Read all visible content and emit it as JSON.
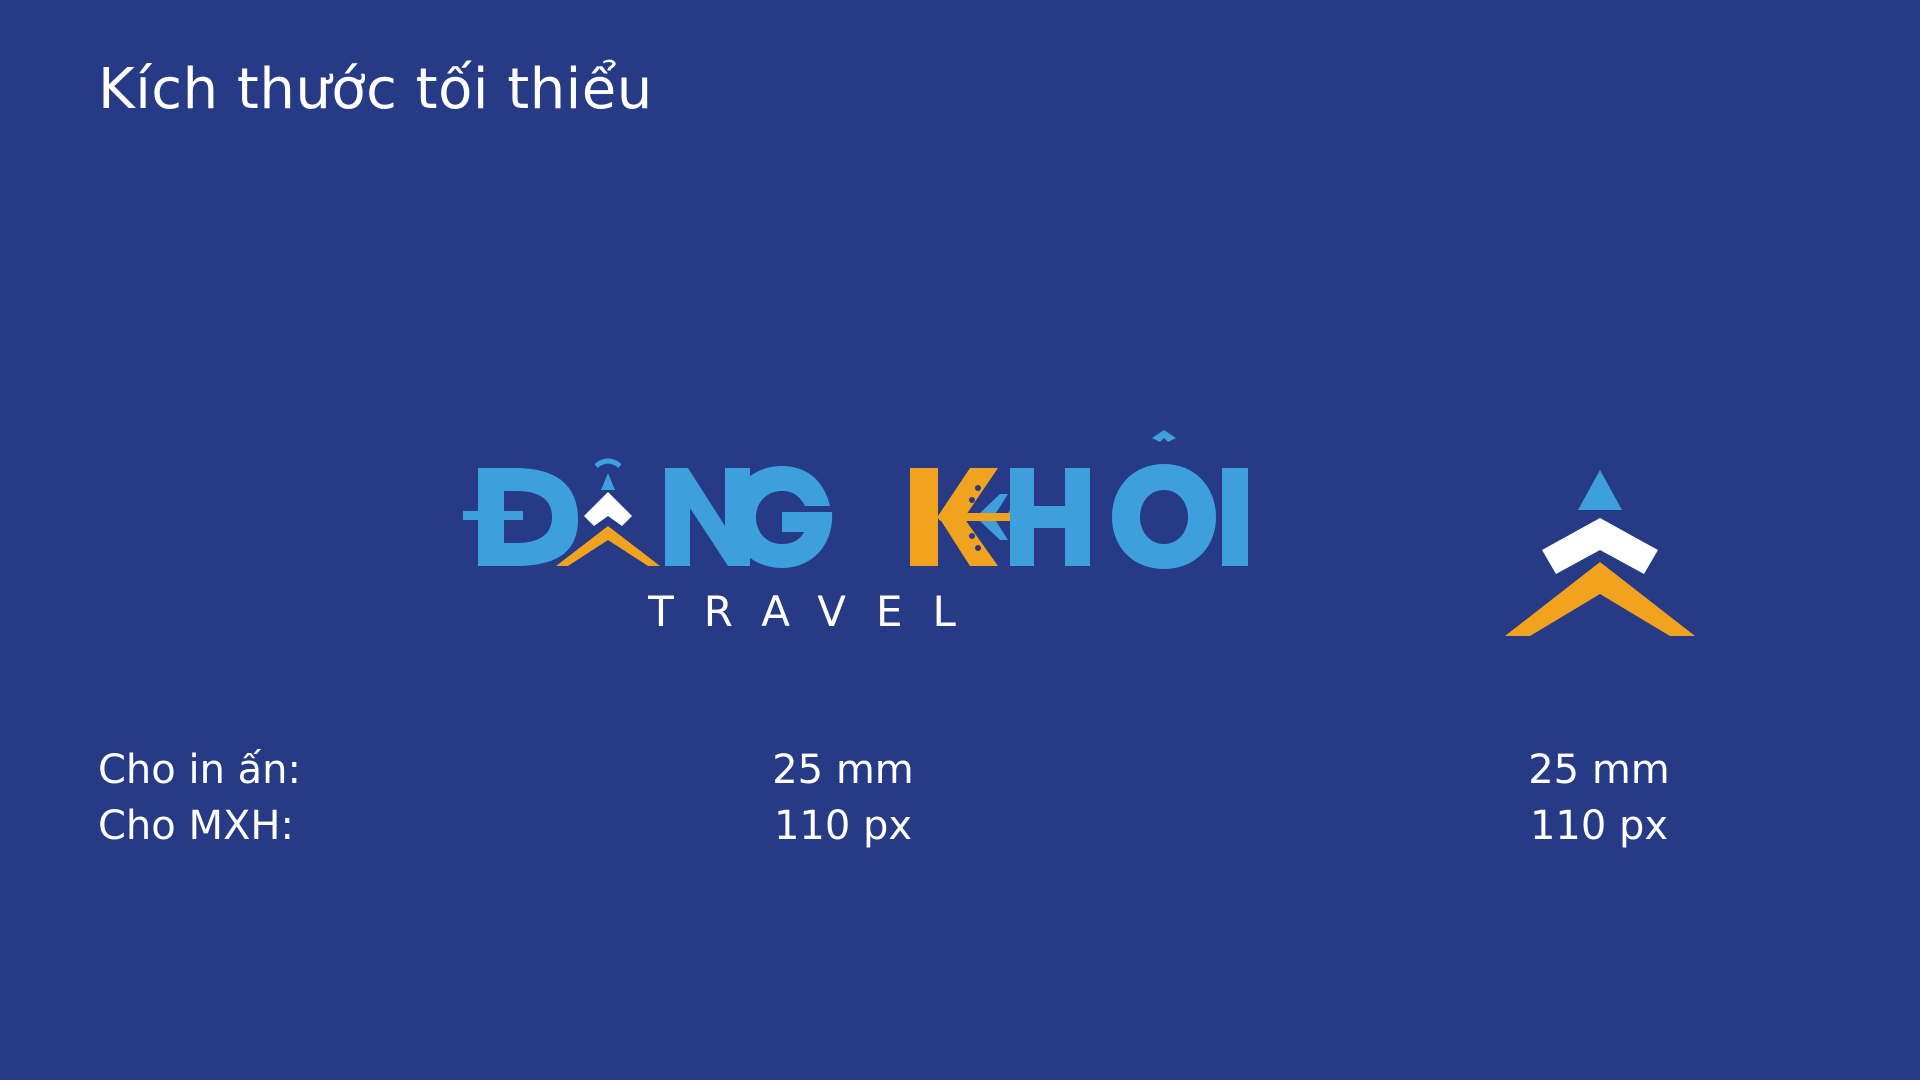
{
  "page": {
    "title": "Kích thước tối thiểu",
    "background_color": "#263a85"
  },
  "logo": {
    "brand_name_word1": "ĐĂNG",
    "brand_name_word2": "KHÔI",
    "tagline": "TRAVEL",
    "colors": {
      "primary_blue": "#3d9fdb",
      "accent_orange": "#f1a320",
      "white": "#ffffff"
    },
    "icons": [
      "chevron-arrow-icon",
      "airplane-icon"
    ]
  },
  "specs": {
    "print": {
      "label": "Cho in ấn:",
      "full_logo": "25 mm",
      "mark": "25 mm"
    },
    "social": {
      "label": "Cho MXH:",
      "full_logo": "110 px",
      "mark": "110 px"
    }
  }
}
